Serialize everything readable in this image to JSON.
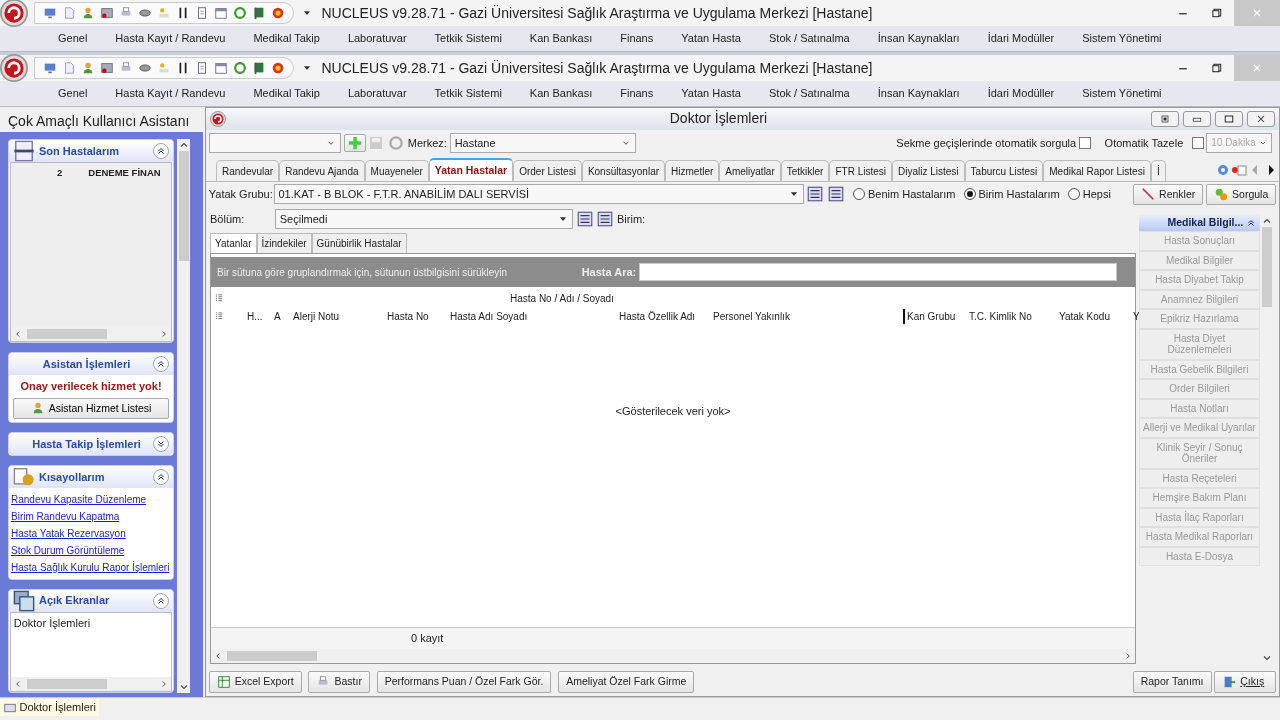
{
  "windows": [
    {
      "title": "NUCLEUS v9.28.71 - Gazi Üniversitesi Sağlık Araştırma ve Uygulama Merkezi [Hastane]",
      "menu": [
        "Genel",
        "Hasta Kayıt / Randevu",
        "Medikal Takip",
        "Laboratuvar",
        "Tetkik Sistemi",
        "Kan Bankası",
        "Finans",
        "Yatan Hasta",
        "Stok / Satınalma",
        "İnsan Kaynakları",
        "İdari Modüller",
        "Sistem Yönetimi"
      ]
    },
    {
      "title": "NUCLEUS v9.28.71 - Gazi Üniversitesi Sağlık Araştırma ve Uygulama Merkezi [Hastane]",
      "menu": [
        "Genel",
        "Hasta Kayıt / Randevu",
        "Medikal Takip",
        "Laboratuvar",
        "Tetkik Sistemi",
        "Kan Bankası",
        "Finans",
        "Yatan Hasta",
        "Stok / Satınalma",
        "İnsan Kaynakları",
        "İdari Modüller",
        "Sistem Yönetimi"
      ]
    }
  ],
  "assistant": {
    "title": "Çok Amaçlı Kullanıcı Asistanı",
    "panels": [
      {
        "kind": "recent",
        "title": "Son Hastalarım",
        "expanded": true,
        "rows": [
          {
            "number": "2",
            "name": "DENEME FİNAN"
          }
        ]
      },
      {
        "kind": "assistant",
        "title": "Asistan İşlemleri",
        "expanded": true,
        "message": "Onay verilecek hizmet yok!",
        "button": "Asistan Hizmet Listesi"
      },
      {
        "kind": "empty",
        "title": "Hasta Takip İşlemleri",
        "expanded": false
      },
      {
        "kind": "links",
        "title": "Kısayollarım",
        "expanded": true,
        "links": [
          "Randevu Kapasite Düzenleme",
          "Birim Randevu Kapatma",
          "Hasta Yatak Rezervasyon",
          "Stok Durum Görüntüleme",
          "Hasta Sağlık Kurulu Rapor İşlemleri"
        ]
      },
      {
        "kind": "screens",
        "title": "Açık Ekranlar",
        "expanded": true,
        "items": [
          "Doktor İşlemleri"
        ]
      }
    ]
  },
  "doctor": {
    "title": "Doktor İşlemleri",
    "merkez_label": "Merkez:",
    "merkez_value": "Hastane",
    "auto_query_label": "Sekme geçişlerinde otomatik sorgula",
    "auto_query_checked": false,
    "auto_refresh_label": "Otomatik Tazele",
    "auto_refresh_checked": false,
    "interval": {
      "value": "10 Dakika",
      "disabled": true
    },
    "tabs": [
      {
        "label": "Randevular",
        "selected": false
      },
      {
        "label": "Randevu Ajanda",
        "selected": false
      },
      {
        "label": "Muayeneler",
        "selected": false
      },
      {
        "label": "Yatan Hastalar",
        "selected": true
      },
      {
        "label": "Order Listesi",
        "selected": false
      },
      {
        "label": "Konsültasyonlar",
        "selected": false
      },
      {
        "label": "Hizmetler",
        "selected": false
      },
      {
        "label": "Ameliyatlar",
        "selected": false
      },
      {
        "label": "Tetkikler",
        "selected": false
      },
      {
        "label": "FTR Listesi",
        "selected": false
      },
      {
        "label": "Diyaliz Listesi",
        "selected": false
      },
      {
        "label": "Taburcu Listesi",
        "selected": false
      },
      {
        "label": "Medikal Rapor Listesi",
        "selected": false
      },
      {
        "label": "İ",
        "selected": false
      }
    ],
    "yatak_label": "Yatak Grubu:",
    "yatak_value": "01.KAT - B BLOK - F.T.R. ANABİLİM DALI SERVİSİ",
    "scope": [
      {
        "label": "Benim Hastalarım",
        "selected": false
      },
      {
        "label": "Birim Hastalarım",
        "selected": true
      },
      {
        "label": "Hepsi",
        "selected": false
      }
    ],
    "colors_button": "Renkler",
    "query_button": "Sorgula",
    "bolum_label": "Bölüm:",
    "bolum_value": "Seçilmedi",
    "birim_label": "Birim:",
    "subtabs": [
      {
        "label": "Yatanlar",
        "selected": true
      },
      {
        "label": "İzindekiler",
        "selected": false
      },
      {
        "label": "Günübirlik Hastalar",
        "selected": false
      }
    ],
    "group_hint": "Bir sütuna göre gruplandırmak için, sütunun üstbilgisini sürükleyin",
    "search_label": "Hasta Ara:",
    "band": "Hasta No / Adı / Soyadı",
    "columns": [
      "H...",
      "A",
      "Alerji Notu",
      "Hasta No",
      "Hasta Adı Soyadı",
      "Hasta Özellik Adı",
      "Personel Yakınlık",
      "Kan Grubu",
      "T.C. Kimlik No",
      "Yatak Kodu",
      "Y"
    ],
    "empty_text": "<Gösterilecek veri yok>",
    "record_count": "0 kayıt",
    "side_panel": {
      "title": "Medikal Bilgil...",
      "expanded": true,
      "items": [
        {
          "label": "Hasta Sonuçları",
          "disabled": true
        },
        {
          "label": "Medikal Bilgiler",
          "disabled": true
        },
        {
          "label": "Hasta Diyabet Takip",
          "disabled": true
        },
        {
          "label": "Anamnez Bilgileri",
          "disabled": true
        },
        {
          "label": "Epikriz Hazırlama",
          "disabled": true
        },
        {
          "label": "Hasta Diyet Düzenlemeleri",
          "disabled": true
        },
        {
          "label": "Hasta Gebelik Bilgileri",
          "disabled": true
        },
        {
          "label": "Order Bilgileri",
          "disabled": true
        },
        {
          "label": "Hasta Notları",
          "disabled": true
        },
        {
          "label": "Allerji ve Medikal Uyarılar",
          "disabled": true
        },
        {
          "label": "Klinik Seyir / Sonuç Öneriler",
          "disabled": true
        },
        {
          "label": "Hasta Reçeteleri",
          "disabled": true
        },
        {
          "label": "Hemşire Bakım Planı",
          "disabled": true
        },
        {
          "label": "Hasta İlaç Raporları",
          "disabled": true
        },
        {
          "label": "Hasta Medikal Raporları",
          "disabled": true
        },
        {
          "label": "Hasta E-Dosya",
          "disabled": true
        }
      ]
    },
    "bottom_buttons": [
      "Excel Export",
      "Bastır",
      "Performans Puan / Özel Fark Gör.",
      "Ameliyat Özel Fark Girme"
    ],
    "right_buttons": [
      "Rapor Tanımı",
      "Çıkış"
    ]
  },
  "status_bar": "Doktor İşlemleri"
}
